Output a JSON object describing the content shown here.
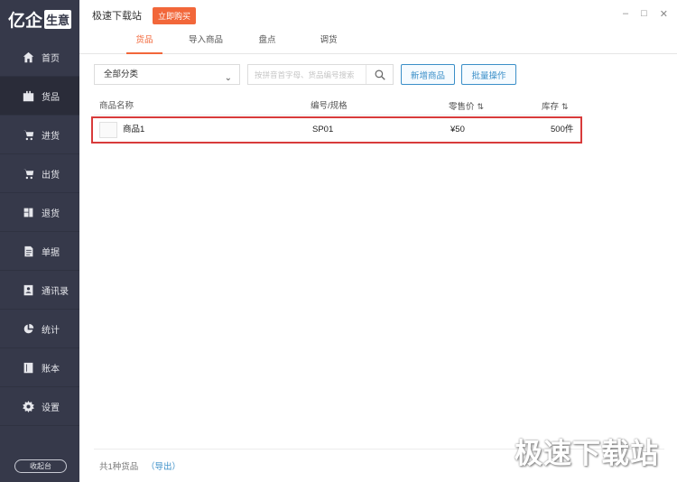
{
  "logo": {
    "main": "亿企",
    "sub": "生意"
  },
  "sidebar": {
    "items": [
      {
        "label": "首页",
        "icon": "home-icon"
      },
      {
        "label": "货品",
        "icon": "goods-icon"
      },
      {
        "label": "进货",
        "icon": "cart-in-icon"
      },
      {
        "label": "出货",
        "icon": "cart-out-icon"
      },
      {
        "label": "退货",
        "icon": "return-icon"
      },
      {
        "label": "单据",
        "icon": "document-icon"
      },
      {
        "label": "通讯录",
        "icon": "contacts-icon"
      },
      {
        "label": "统计",
        "icon": "pie-chart-icon"
      },
      {
        "label": "账本",
        "icon": "ledger-icon"
      },
      {
        "label": "设置",
        "icon": "gear-icon"
      }
    ],
    "active_index": 1,
    "collapse_label": "收起台"
  },
  "titlebar": {
    "title": "极速下载站",
    "buy_label": "立即购买"
  },
  "window_controls": {
    "minimize": "–",
    "maximize": "□",
    "close": "✕"
  },
  "tabs": [
    {
      "label": "货品"
    },
    {
      "label": "导入商品"
    },
    {
      "label": "盘点"
    },
    {
      "label": "调货"
    }
  ],
  "toolbar": {
    "category_value": "全部分类",
    "search_placeholder": "按拼音首字母、货品编号搜索",
    "add_label": "新增商品",
    "batch_label": "批量操作"
  },
  "table": {
    "headers": [
      "商品名称",
      "编号/规格",
      "零售价",
      "库存"
    ],
    "rows": [
      {
        "name": "商品1",
        "code": "SP01",
        "price": "¥50",
        "stock": "500件"
      }
    ]
  },
  "footer": {
    "count_text": "共1种货品",
    "export_label": "（导出）"
  },
  "watermark": "极速下载站",
  "colors": {
    "accent": "#f2673a",
    "link": "#3b8fc8",
    "sidebar_bg": "#36394a",
    "highlight_border": "#d83b3b"
  }
}
